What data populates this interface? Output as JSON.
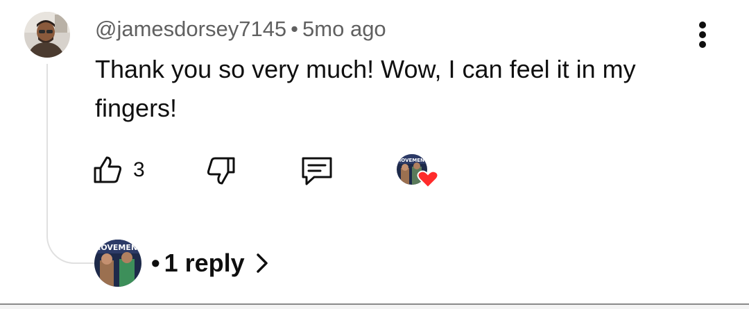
{
  "comment": {
    "author": "@jamesdorsey7145",
    "separator": "•",
    "time_ago": "5mo ago",
    "text": "Thank you so very much! Wow, I can feel it in my fingers!",
    "like_count": "3"
  },
  "icons": {
    "more": "more-vert-icon",
    "like": "thumb-up-icon",
    "dislike": "thumb-down-icon",
    "reply": "comment-reply-icon",
    "heart": "creator-heart-icon",
    "chevron": "chevron-right-icon"
  },
  "creator_badge": {
    "logo_text": "MOVEMENT"
  },
  "replies": {
    "bullet": "•",
    "label": "1 reply"
  },
  "colors": {
    "heart": "#ff2b2b",
    "meta_text": "#606060",
    "thread_line": "#e0e0e0"
  }
}
